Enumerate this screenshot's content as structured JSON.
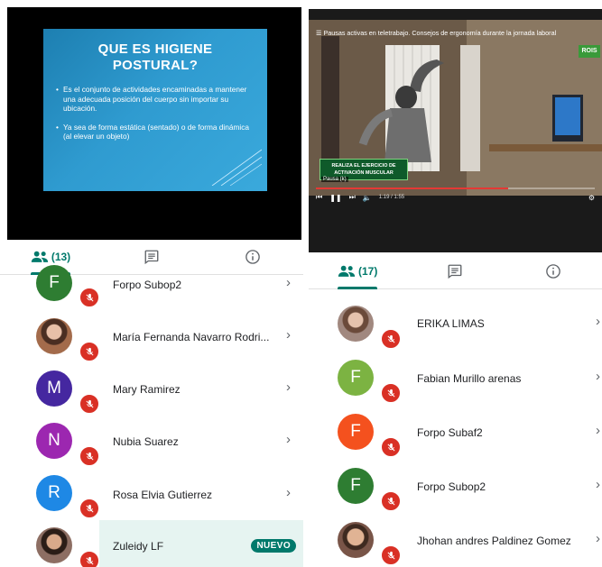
{
  "left": {
    "slide": {
      "title_line1": "QUE ES HIGIENE",
      "title_line2": "POSTURAL?",
      "bullet1": "Es el conjunto de actividades encaminadas a mantener una adecuada posición del cuerpo sin importar su ubicación.",
      "bullet2": "Ya sea de forma estática (sentado) o de forma dinámica (al elevar un objeto)"
    },
    "tabs": {
      "participants_count": "(13)"
    },
    "participants": [
      {
        "name": "Forpo Subop2",
        "initial": "F",
        "color": "#2e7d32"
      },
      {
        "name": "María Fernanda Navarro Rodri...",
        "initial": "",
        "color": "#6d4c41"
      },
      {
        "name": "Mary Ramirez",
        "initial": "M",
        "color": "#4527a0"
      },
      {
        "name": "Nubia Suarez",
        "initial": "N",
        "color": "#9c27b0"
      },
      {
        "name": "Rosa Elvia Gutierrez",
        "initial": "R",
        "color": "#1e88e5"
      },
      {
        "name": "Zuleidy LF",
        "initial": "",
        "color": "#8d6e63",
        "badge": "NUEVO"
      }
    ]
  },
  "right": {
    "video": {
      "title": "Pausas activas en teletrabajo. Consejos de ergonomía durante la jornada laboral",
      "logo": "ROIS",
      "banner_line1": "REALIZA EL EJERCICIO DE",
      "banner_line2": "ACTIVACIÓN MUSCULAR",
      "pause_label": "Pausa (k)",
      "time": "1:19 / 1:55",
      "progress": 0.69
    },
    "tabs": {
      "participants_count": "(17)"
    },
    "participants": [
      {
        "name": "ERIKA LIMAS",
        "initial": "",
        "color": "#a1887f"
      },
      {
        "name": "Fabian Murillo arenas",
        "initial": "F",
        "color": "#7cb342"
      },
      {
        "name": "Forpo Subaf2",
        "initial": "F",
        "color": "#f4511e"
      },
      {
        "name": "Forpo Subop2",
        "initial": "F",
        "color": "#2e7d32"
      },
      {
        "name": "Jhohan andres Paldinez Gomez",
        "initial": "",
        "color": "#795548"
      }
    ]
  },
  "colors": {
    "accent": "#00796b",
    "mic_off": "#d93025"
  }
}
